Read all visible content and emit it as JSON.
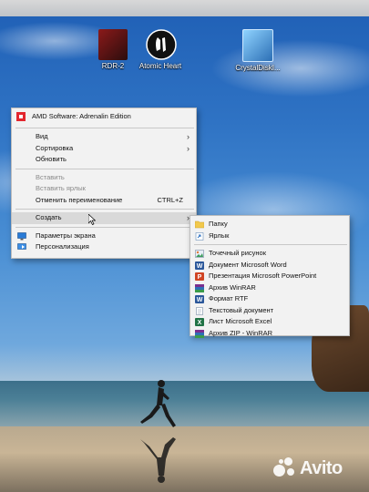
{
  "desktop": {
    "icons": [
      {
        "label": "RDR-2",
        "icon": "rdr2-game-icon"
      },
      {
        "label": "Atomic Heart",
        "icon": "unreal-engine-icon"
      },
      {
        "label": "CrystalDiskI...",
        "icon": "crystaldisk-icon"
      }
    ]
  },
  "context_menu": {
    "header": "AMD Software: Adrenalin Edition",
    "items": [
      {
        "label": "Вид",
        "submenu": true
      },
      {
        "label": "Сортировка",
        "submenu": true
      },
      {
        "label": "Обновить"
      },
      {
        "label": "Вставить",
        "disabled": true
      },
      {
        "label": "Вставить ярлык",
        "disabled": true
      },
      {
        "label": "Отменить переименование",
        "shortcut": "CTRL+Z"
      },
      {
        "label": "Создать",
        "submenu": true,
        "highlighted": true
      },
      {
        "label": "Параметры экрана",
        "icon": "display-settings-icon"
      },
      {
        "label": "Персонализация",
        "icon": "personalization-icon"
      }
    ],
    "arrow_glyph": "›"
  },
  "submenu_create": {
    "items": [
      {
        "label": "Папку",
        "icon": "folder-icon"
      },
      {
        "label": "Ярлык",
        "icon": "shortcut-icon"
      },
      {
        "label": "Точечный рисунок",
        "icon": "bitmap-icon"
      },
      {
        "label": "Документ Microsoft Word",
        "icon": "word-doc-icon"
      },
      {
        "label": "Презентация Microsoft PowerPoint",
        "icon": "powerpoint-icon"
      },
      {
        "label": "Архив WinRAR",
        "icon": "winrar-archive-icon"
      },
      {
        "label": "Формат RTF",
        "icon": "rtf-icon"
      },
      {
        "label": "Текстовый документ",
        "icon": "text-document-icon"
      },
      {
        "label": "Лист Microsoft Excel",
        "icon": "excel-icon"
      },
      {
        "label": "Архив ZIP - WinRAR",
        "icon": "zip-archive-icon"
      }
    ]
  },
  "watermark": {
    "text": "Avito"
  },
  "colors": {
    "amd_red": "#e3262e",
    "menu_bg": "#f2f2f2",
    "highlight": "#d9d9d9"
  }
}
